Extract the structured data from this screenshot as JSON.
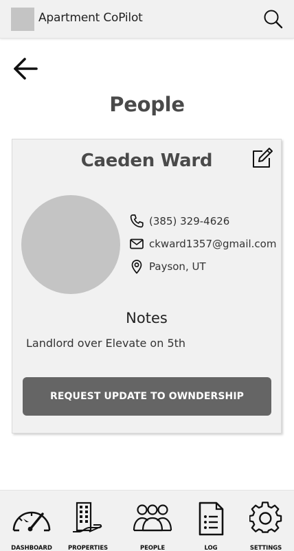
{
  "header": {
    "app_title": "Apartment CoPilot",
    "search_icon": "search-icon",
    "logo_icon": "logo-placeholder"
  },
  "page": {
    "title": "People",
    "back_icon": "arrow-left-icon"
  },
  "person": {
    "name": "Caeden Ward",
    "phone": "(385) 329-4626",
    "email": "ckward1357@gmail.com",
    "location": "Payson, UT",
    "notes_title": "Notes",
    "notes": "Landlord over Elevate on 5th",
    "action_button": "REQUEST UPDATE TO OWNDERSHIP"
  },
  "bottom_nav": {
    "items": [
      {
        "label": "DASHBOARD",
        "icon": "speedometer-icon"
      },
      {
        "label": "PROPERTIES",
        "icon": "building-icon"
      },
      {
        "label": "PEOPLE",
        "icon": "people-icon"
      },
      {
        "label": "LOG",
        "icon": "document-icon"
      },
      {
        "label": "SETTINGS",
        "icon": "gear-icon"
      }
    ]
  },
  "colors": {
    "header_bg": "#f1f1f1",
    "card_bg": "#f1f1f1",
    "avatar_bg": "#c4c4c4",
    "button_bg": "#656565",
    "title_text": "#4a4a4a"
  }
}
